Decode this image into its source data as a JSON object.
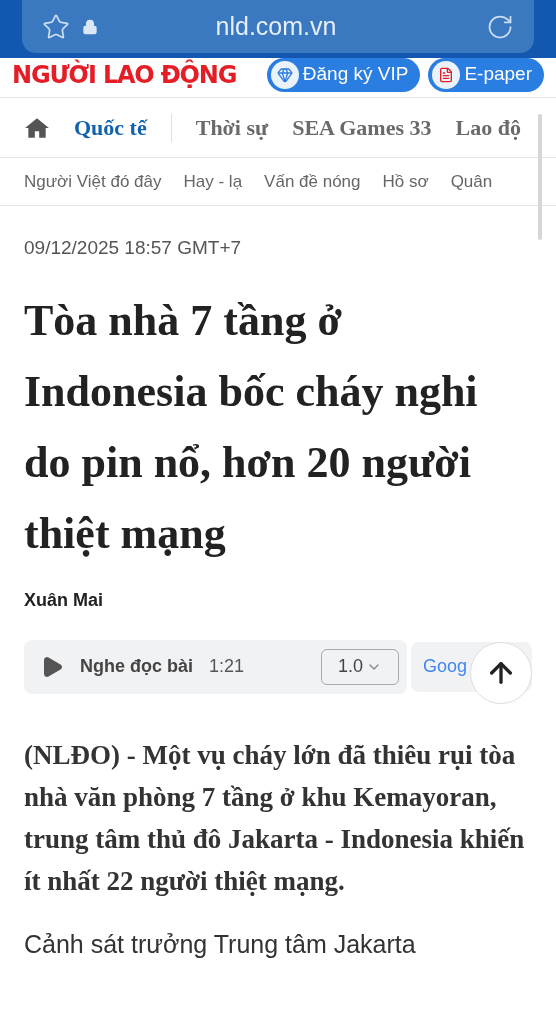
{
  "browser": {
    "url": "nld.com.vn"
  },
  "header": {
    "logo": "NGƯỜI LAO ĐỘNG",
    "buttons": [
      {
        "label": "Đăng ký VIP",
        "kind": "vip"
      },
      {
        "label": "E-paper",
        "kind": "epaper"
      }
    ]
  },
  "main_nav": [
    {
      "label": "Quốc tế",
      "selected": true
    },
    {
      "label": "Thời sự",
      "selected": false
    },
    {
      "label": "SEA Games 33",
      "selected": false
    },
    {
      "label": "Lao độ",
      "selected": false
    }
  ],
  "sub_nav": [
    "Người Việt đó đây",
    "Hay - lạ",
    "Vấn đề nóng",
    "Hồ sơ",
    "Quân"
  ],
  "article": {
    "date": "09/12/2025 18:57 GMT+7",
    "title": "Tòa nhà 7 tầng ở Indonesia bốc cháy nghi do pin nổ, hơn 20 người thiệt mạng",
    "author": "Xuân Mai",
    "audio": {
      "label": "Nghe đọc bài",
      "duration": "1:21",
      "speed": "1.0",
      "provider": "Goog"
    },
    "lead": "(NLĐO) - Một vụ cháy lớn đã thiêu rụi tòa nhà văn phòng 7 tầng ở khu Kemayoran, trung tâm thủ đô Jakarta - Indonesia khiến ít nhất 22 người thiệt mạng.",
    "body": "Cảnh sát trưởng Trung tâm Jakarta"
  }
}
